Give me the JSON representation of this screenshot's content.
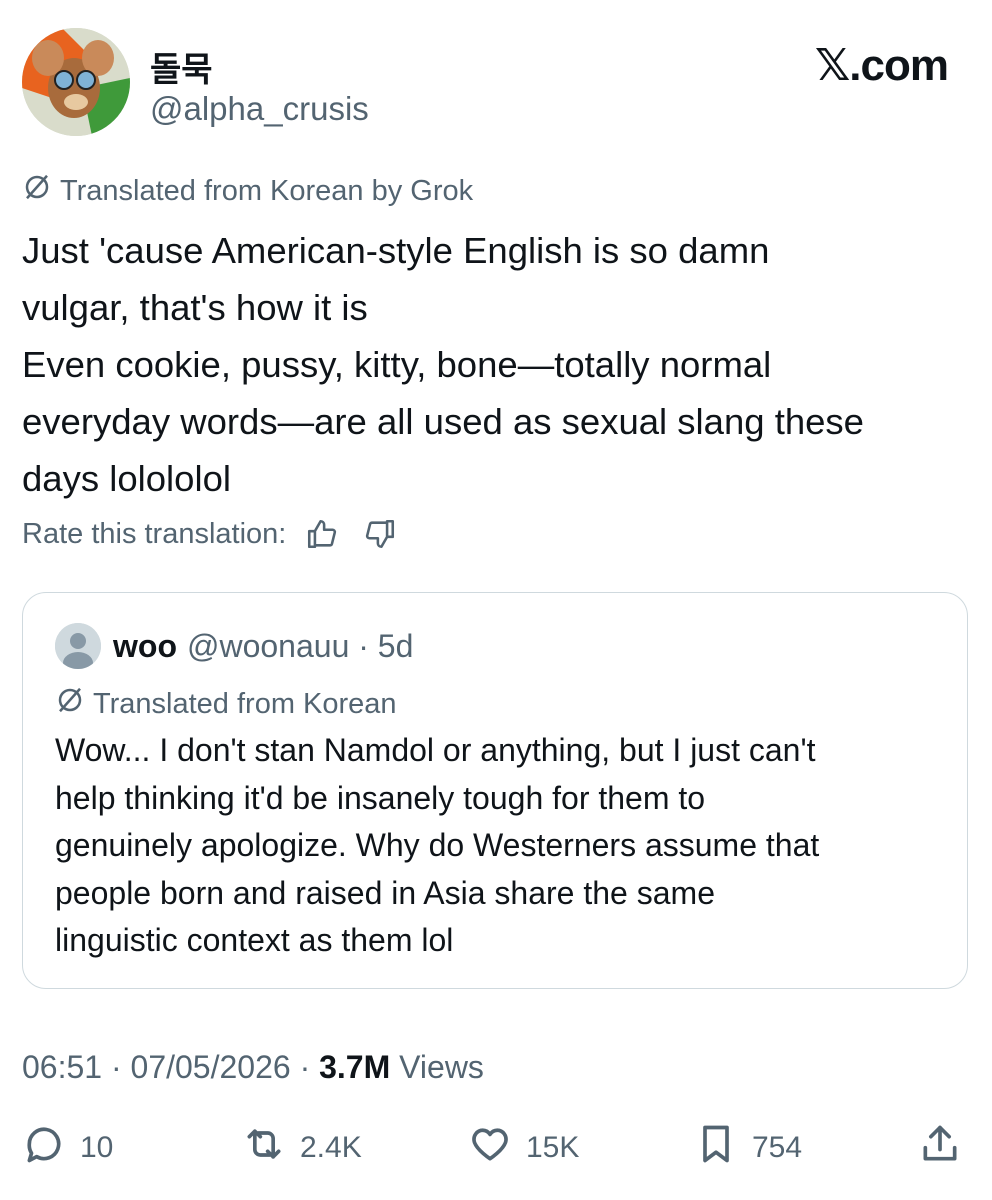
{
  "author": {
    "display_name": "돌묵",
    "handle": "@alpha_crusis"
  },
  "brand": "𝕏.com",
  "translation_note": "Translated from Korean by Grok",
  "tweet_lines": [
    "Just 'cause American-style English is so damn",
    "vulgar, that's how it is",
    "Even cookie, pussy, kitty, bone—totally normal",
    "everyday words—are all used as sexual slang these",
    "days lolololol"
  ],
  "rate_label": "Rate this translation:",
  "quoted": {
    "name": "woo",
    "handle_time": "@woonauu · 5d",
    "translation_note": "Translated from Korean",
    "lines": [
      "Wow... I don't stan Namdol or anything, but I just can't",
      "help thinking it'd be insanely tough for them to",
      "genuinely apologize. Why do Westerners assume that",
      "people born and raised in Asia share the same",
      "linguistic context as them lol"
    ]
  },
  "meta": {
    "time_date": "06:51 · 07/05/2026 · ",
    "views_count": "3.7M",
    "views_label": " Views"
  },
  "actions": {
    "replies": "10",
    "reposts": "2.4K",
    "likes": "15K",
    "bookmarks": "754"
  },
  "icons": [
    "grok-translate-icon",
    "thumbs-up-icon",
    "thumbs-down-icon",
    "reply-icon",
    "repost-icon",
    "like-icon",
    "bookmark-icon",
    "share-icon"
  ],
  "colors": {
    "text": "#0f1419",
    "secondary": "#536471",
    "border": "#cfd9de"
  }
}
